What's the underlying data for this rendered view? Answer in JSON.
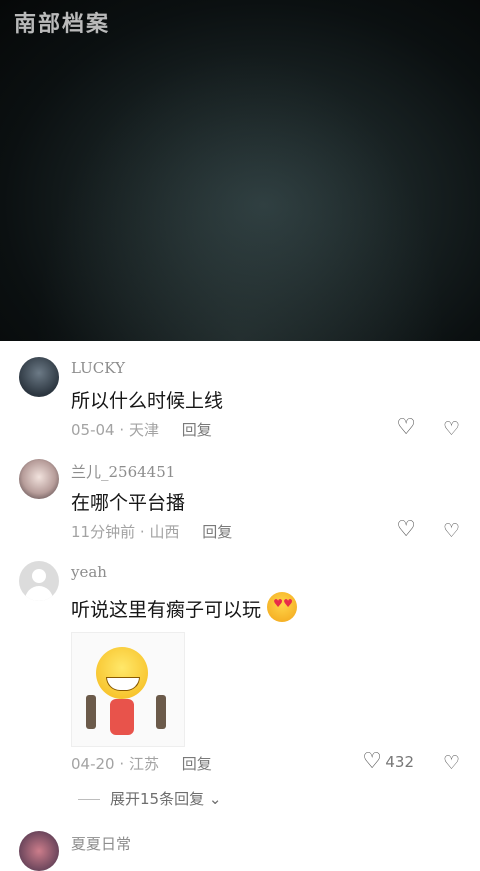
{
  "video": {
    "watermark": "南部档案"
  },
  "comments": [
    {
      "username": "LUCKY",
      "text": "所以什么时候上线",
      "date": "05-04",
      "location": "天津",
      "reply_label": "回复",
      "likes": ""
    },
    {
      "username": "兰儿_2564451",
      "text": "在哪个平台播",
      "date": "11分钟前",
      "location": "山西",
      "reply_label": "回复",
      "likes": ""
    },
    {
      "username": "yeah",
      "text": "听说这里有瘸子可以玩",
      "emoji": "heart-eyes-emoji",
      "date": "04-20",
      "location": "江苏",
      "reply_label": "回复",
      "likes": "432",
      "expand_label": "展开15条回复"
    },
    {
      "username": "夏夏日常"
    }
  ],
  "separator": "·"
}
